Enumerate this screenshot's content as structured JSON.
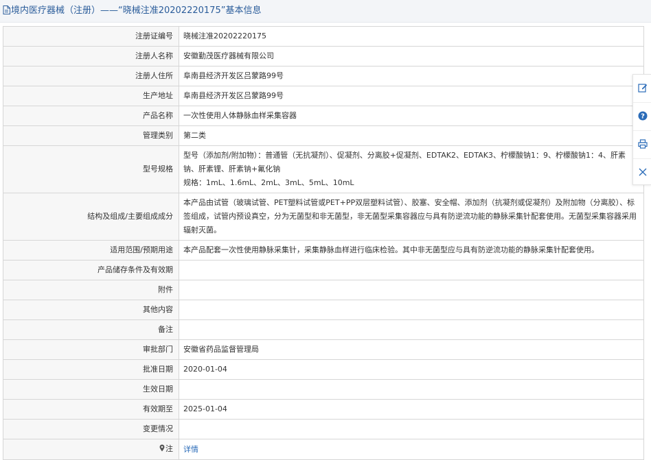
{
  "header": {
    "title": "境内医疗器械（注册）——“晓械注准20202220175”基本信息"
  },
  "rows": [
    {
      "label": "注册证编号",
      "value": "晓械注准20202220175"
    },
    {
      "label": "注册人名称",
      "value": "安徽勤茂医疗器械有限公司"
    },
    {
      "label": "注册人住所",
      "value": "阜南县经济开发区吕蒙路99号"
    },
    {
      "label": "生产地址",
      "value": "阜南县经济开发区吕蒙路99号"
    },
    {
      "label": "产品名称",
      "value": "一次性使用人体静脉血样采集容器"
    },
    {
      "label": "管理类别",
      "value": "第二类"
    },
    {
      "label": "型号规格",
      "value": "型号（添加剂/附加物）：普通管（无抗凝剂）、促凝剂、分离胶+促凝剂、EDTAK2、EDTAK3、柠檬酸钠1：9、柠檬酸钠1：4、肝素钠、肝素锂、肝素钠+氟化钠",
      "value2": "规格：1mL、1.6mL、2mL、3mL、5mL、10mL"
    },
    {
      "label": "结构及组成/主要组成成分",
      "value": "本产品由试管（玻璃试管、PET塑料试管或PET+PP双层塑料试管）、胶塞、安全帽、添加剂（抗凝剂或促凝剂）及附加物（分离胶）、标签组成，试管内预设真空，分为无菌型和非无菌型，非无菌型采集容器应与具有防逆流功能的静脉采集针配套使用。无菌型采集容器采用辐射灭菌。"
    },
    {
      "label": "适用范围/预期用途",
      "value": "本产品配套一次性使用静脉采集针，采集静脉血样进行临床检验。其中非无菌型应与具有防逆流功能的静脉采集针配套使用。"
    },
    {
      "label": "产品储存条件及有效期",
      "value": ""
    },
    {
      "label": "附件",
      "value": ""
    },
    {
      "label": "其他内容",
      "value": ""
    },
    {
      "label": "备注",
      "value": ""
    },
    {
      "label": "审批部门",
      "value": "安徽省药品监督管理局"
    },
    {
      "label": "批准日期",
      "value": "2020-01-04"
    },
    {
      "label": "生效日期",
      "value": ""
    },
    {
      "label": "有效期至",
      "value": "2025-01-04"
    },
    {
      "label": "变更情况",
      "value": ""
    }
  ],
  "note_row": {
    "label": "注",
    "link_text": "详情"
  },
  "side_tools": [
    {
      "icon": "edit-icon"
    },
    {
      "icon": "help-icon"
    },
    {
      "icon": "print-icon"
    },
    {
      "icon": "close-icon"
    }
  ],
  "colors": {
    "title": "#2a5c9a",
    "link": "#2a6bb8",
    "label_bg": "#f7f7f7",
    "border": "#d6d6d6"
  }
}
